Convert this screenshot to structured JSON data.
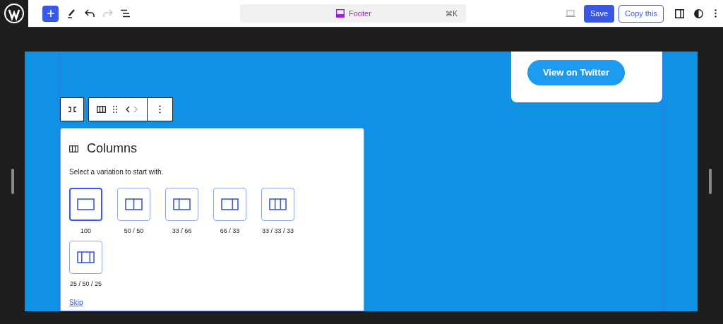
{
  "toolbar": {
    "redo_disabled": true
  },
  "command_bar": {
    "label": "Footer",
    "shortcut": "⌘K"
  },
  "actions": {
    "save": "Save",
    "copy": "Copy this"
  },
  "canvas": {
    "card_button": "View on Twitter"
  },
  "placeholder": {
    "title": "Columns",
    "instructions": "Select a variation to start with.",
    "variations": [
      {
        "label": "100",
        "kind": "full",
        "selected": true
      },
      {
        "label": "50 / 50",
        "kind": "halves",
        "selected": false
      },
      {
        "label": "33 / 66",
        "kind": "narrowwide",
        "selected": false
      },
      {
        "label": "66 / 33",
        "kind": "widenarrow",
        "selected": false
      },
      {
        "label": "33 / 33 / 33",
        "kind": "thirds",
        "selected": false
      },
      {
        "label": "25 / 50 / 25",
        "kind": "widecenter",
        "selected": false
      }
    ],
    "skip": "Skip"
  }
}
